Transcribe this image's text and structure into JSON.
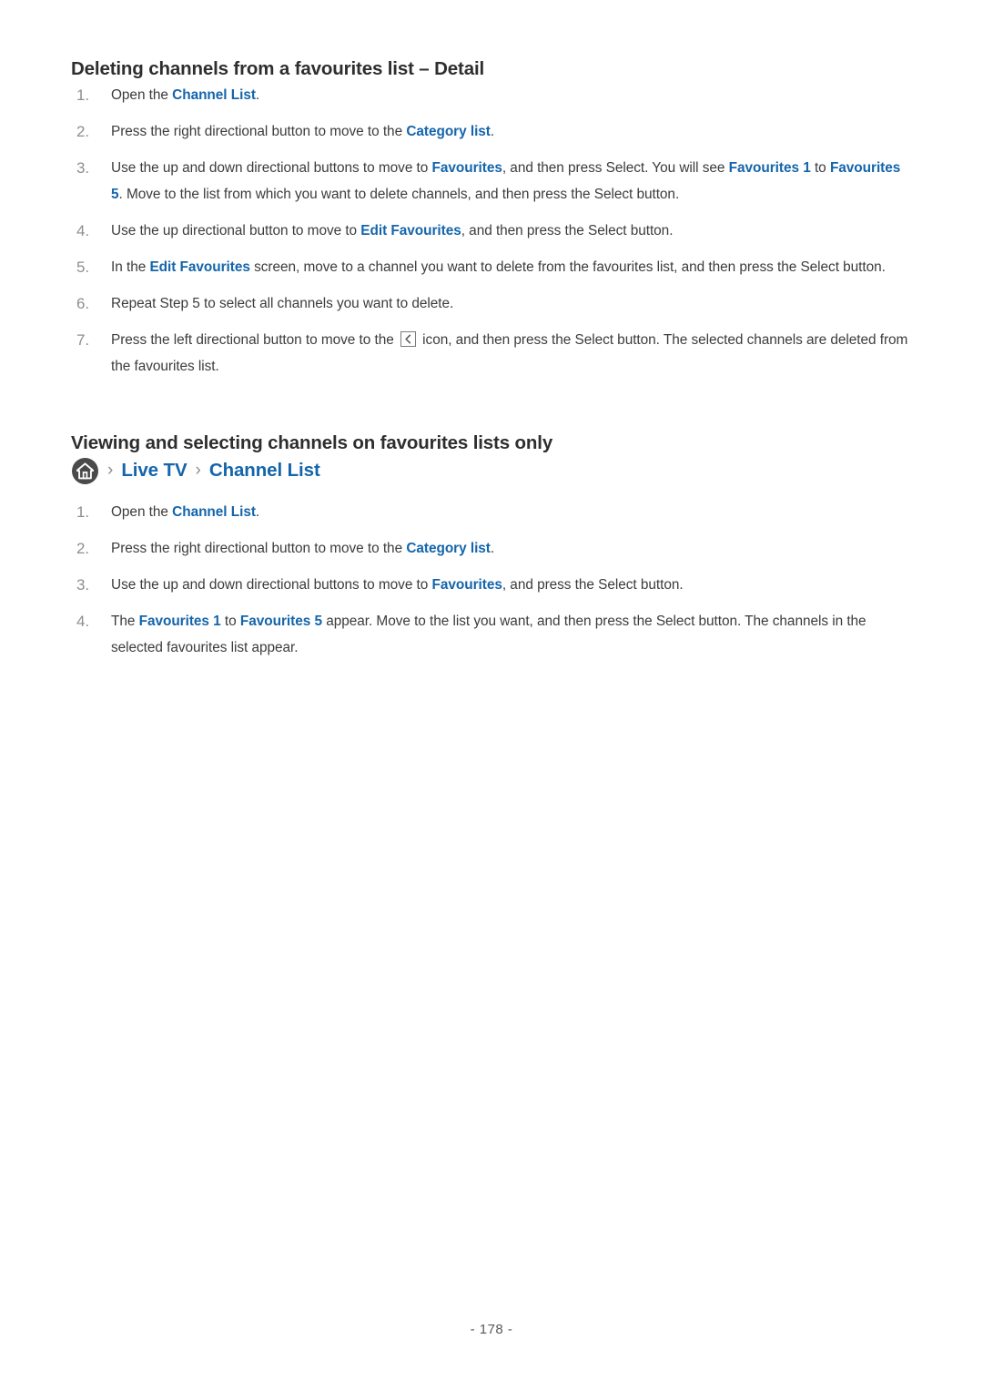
{
  "document": {
    "page_number": "- 178 -"
  },
  "sections": [
    {
      "heading": "Deleting channels from a favourites list – Detail",
      "steps": [
        {
          "number": "1.",
          "parts": [
            {
              "t": "Open the ",
              "style": "plain"
            },
            {
              "t": "Channel List",
              "style": "link"
            },
            {
              "t": ".",
              "style": "plain"
            }
          ]
        },
        {
          "number": "2.",
          "parts": [
            {
              "t": "Press the right directional button to move to the ",
              "style": "plain"
            },
            {
              "t": "Category list",
              "style": "link"
            },
            {
              "t": ".",
              "style": "plain"
            }
          ]
        },
        {
          "number": "3.",
          "parts": [
            {
              "t": "Use the up and down directional buttons to move to ",
              "style": "plain"
            },
            {
              "t": "Favourites",
              "style": "link"
            },
            {
              "t": ", and then press Select. You will see ",
              "style": "plain"
            },
            {
              "t": "Favourites 1",
              "style": "link"
            },
            {
              "t": " to ",
              "style": "plain"
            },
            {
              "t": "Favourites 5",
              "style": "link"
            },
            {
              "t": ". Move to the list from which you want to delete channels, and then press the Select button.",
              "style": "plain"
            }
          ]
        },
        {
          "number": "4.",
          "parts": [
            {
              "t": "Use the up directional button to move to ",
              "style": "plain"
            },
            {
              "t": "Edit Favourites",
              "style": "link"
            },
            {
              "t": ", and then press the Select button.",
              "style": "plain"
            }
          ]
        },
        {
          "number": "5.",
          "parts": [
            {
              "t": "In the ",
              "style": "plain"
            },
            {
              "t": "Edit Favourites",
              "style": "link"
            },
            {
              "t": " screen, move to a channel you want to delete from the favourites list, and then press the Select button.",
              "style": "plain"
            }
          ]
        },
        {
          "number": "6.",
          "parts": [
            {
              "t": "Repeat Step 5 to select all channels you want to delete.",
              "style": "plain"
            }
          ]
        },
        {
          "number": "7.",
          "parts": [
            {
              "t": "Press the left directional button to move to the ",
              "style": "plain"
            },
            {
              "t": "back-arrow-icon",
              "style": "icon"
            },
            {
              "t": " icon, and then press the Select button. The selected channels are deleted from the favourites list.",
              "style": "plain"
            }
          ]
        }
      ]
    },
    {
      "heading": "Viewing and selecting channels on favourites lists only",
      "breadcrumb": {
        "home_icon": "home-icon",
        "separator": "›",
        "items": [
          "Live TV",
          "Channel List"
        ]
      },
      "steps": [
        {
          "number": "1.",
          "parts": [
            {
              "t": "Open the ",
              "style": "plain"
            },
            {
              "t": "Channel List",
              "style": "link"
            },
            {
              "t": ".",
              "style": "plain"
            }
          ]
        },
        {
          "number": "2.",
          "parts": [
            {
              "t": "Press the right directional button to move to the ",
              "style": "plain"
            },
            {
              "t": "Category list",
              "style": "link"
            },
            {
              "t": ".",
              "style": "plain"
            }
          ]
        },
        {
          "number": "3.",
          "parts": [
            {
              "t": "Use the up and down directional buttons to move to ",
              "style": "plain"
            },
            {
              "t": "Favourites",
              "style": "link"
            },
            {
              "t": ", and press the Select button.",
              "style": "plain"
            }
          ]
        },
        {
          "number": "4.",
          "parts": [
            {
              "t": "The ",
              "style": "plain"
            },
            {
              "t": "Favourites 1",
              "style": "link"
            },
            {
              "t": " to ",
              "style": "plain"
            },
            {
              "t": "Favourites 5",
              "style": "link"
            },
            {
              "t": " appear. Move to the list you want, and then press the Select button. The channels in the selected favourites list appear.",
              "style": "plain"
            }
          ]
        }
      ]
    }
  ],
  "colors": {
    "link": "#1465ab",
    "body_text": "#3c3c3c",
    "heading_text": "#2e2e2e",
    "number_text": "#8e8e8e",
    "home_icon_bg": "#4a4a4a",
    "background": "#ffffff"
  }
}
